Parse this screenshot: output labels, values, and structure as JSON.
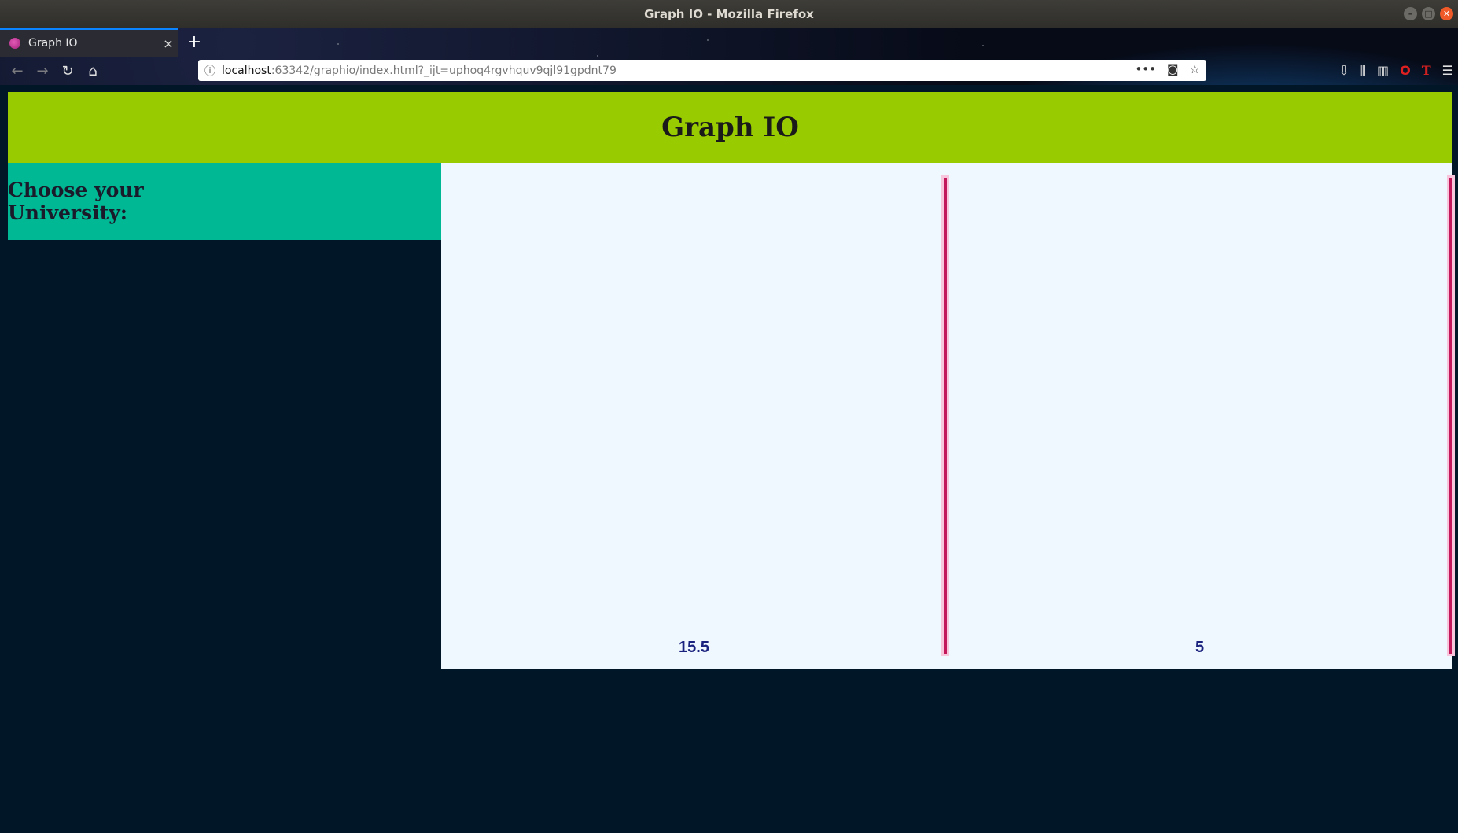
{
  "window": {
    "title": "Graph IO - Mozilla Firefox"
  },
  "browser": {
    "tab_title": "Graph IO",
    "url_host": "localhost",
    "url_rest": ":63342/graphio/index.html?_ijt=uphoq4rgvhquv9qjl91gpdnt79"
  },
  "page": {
    "title": "Graph IO",
    "sidebar_heading": "Choose your University:"
  },
  "chart_data": {
    "type": "bar",
    "categories": [
      "",
      ""
    ],
    "values": [
      15.5,
      5
    ],
    "labels": [
      "15.5",
      "5"
    ],
    "bar_color": "#c2185b",
    "title": "",
    "xlabel": "",
    "ylabel": ""
  }
}
